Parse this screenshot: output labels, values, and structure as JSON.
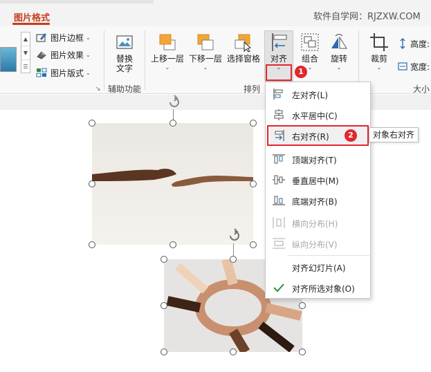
{
  "tabs": {
    "active": "图片格式"
  },
  "watermark": "软件自学网：RJZXW.COM",
  "picture_styles": {
    "border": "图片边框",
    "effects": "图片效果",
    "layout": "图片版式"
  },
  "accessibility": {
    "alt_text_line1": "替换",
    "alt_text_line2": "文字",
    "group_label": "辅助功能"
  },
  "arrange": {
    "bring_forward": "上移一层",
    "send_backward": "下移一层",
    "selection_pane": "选择窗格",
    "align": "对齐",
    "group": "组合",
    "rotate": "旋转",
    "group_label": "排列"
  },
  "size": {
    "crop": "裁剪",
    "height_label": "高度:",
    "width_label": "宽度:",
    "group_label": "大小"
  },
  "align_menu": {
    "items": [
      {
        "label": "左对齐(L)",
        "icon": "align-left-icon",
        "enabled": true
      },
      {
        "label": "水平居中(C)",
        "icon": "align-center-icon",
        "enabled": true
      },
      {
        "label": "右对齐(R)",
        "icon": "align-right-icon",
        "enabled": true,
        "hovered": true
      },
      {
        "label": "顶端对齐(T)",
        "icon": "align-top-icon",
        "enabled": true
      },
      {
        "label": "垂直居中(M)",
        "icon": "align-middle-icon",
        "enabled": true
      },
      {
        "label": "底端对齐(B)",
        "icon": "align-bottom-icon",
        "enabled": true
      },
      {
        "label": "横向分布(H)",
        "icon": "distribute-horizontal-icon",
        "enabled": false
      },
      {
        "label": "纵向分布(V)",
        "icon": "distribute-vertical-icon",
        "enabled": false
      },
      {
        "label": "对齐幻灯片(A)",
        "icon": "",
        "enabled": true
      },
      {
        "label": "对齐所选对象(O)",
        "icon": "checkmark-icon",
        "enabled": true,
        "checked": true
      }
    ]
  },
  "tooltip": "对象右对齐",
  "badges": {
    "step1": "1",
    "step2": "2"
  },
  "colors": {
    "accent": "#c43e1c",
    "highlight": "#e0282d",
    "icon_blue": "#2b6cb0",
    "icon_orange": "#f3a53a"
  }
}
